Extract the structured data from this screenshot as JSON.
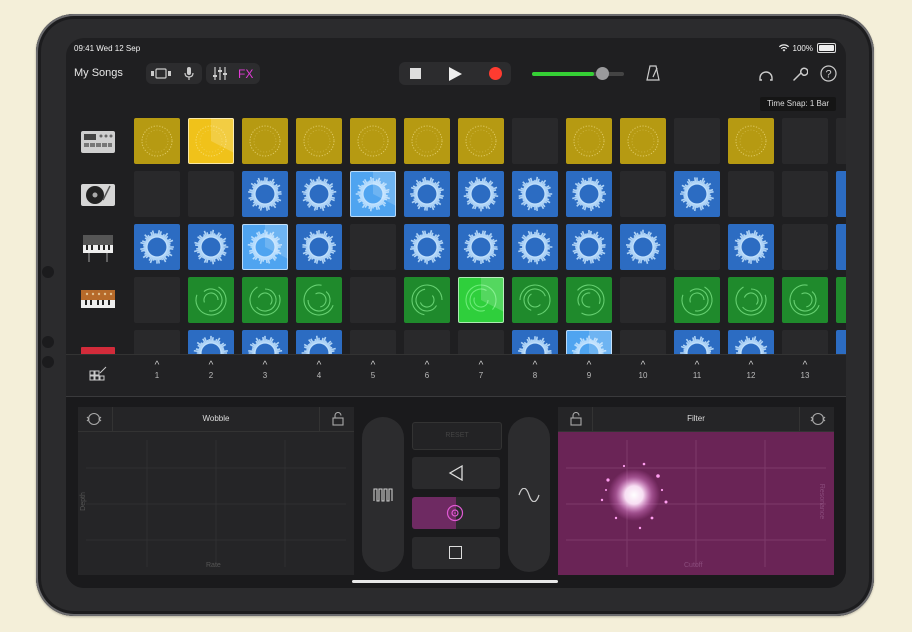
{
  "status_bar": {
    "time": "09:41",
    "date": "Wed 12 Sep",
    "battery": "100%"
  },
  "toolbar": {
    "my_songs": "My Songs",
    "fx_label": "FX",
    "time_snap": "Time Snap: 1 Bar"
  },
  "colors": {
    "accent_fx": "#e23bd6",
    "record": "#ff3b30",
    "volume": "#35d035"
  },
  "tracks": [
    {
      "icon": "drum-machine-icon",
      "color": "yellow",
      "cells": [
        "full",
        "playing",
        "full",
        "full",
        "full",
        "full",
        "full",
        "empty",
        "full",
        "full",
        "empty",
        "full",
        "empty"
      ]
    },
    {
      "icon": "turntable-icon",
      "color": "blue",
      "cells": [
        "empty",
        "empty",
        "full",
        "full",
        "playing",
        "full",
        "full",
        "full",
        "full",
        "empty",
        "full",
        "empty",
        "empty"
      ]
    },
    {
      "icon": "synth-keyboard-icon",
      "color": "blue",
      "cells": [
        "full",
        "full",
        "playing",
        "full",
        "empty",
        "full",
        "full",
        "full",
        "full",
        "full",
        "empty",
        "full",
        "empty"
      ]
    },
    {
      "icon": "vintage-synth-icon",
      "color": "green",
      "cells": [
        "empty",
        "full",
        "full",
        "full",
        "empty",
        "full",
        "playing",
        "full",
        "full",
        "empty",
        "full",
        "full",
        "full"
      ]
    },
    {
      "icon": "red-keyboard-icon",
      "color": "blue",
      "cells": [
        "empty",
        "full",
        "full",
        "full",
        "empty",
        "empty",
        "empty",
        "full",
        "playing",
        "empty",
        "full",
        "full",
        "empty"
      ]
    }
  ],
  "column_triggers": [
    "1",
    "2",
    "3",
    "4",
    "5",
    "6",
    "7",
    "8",
    "9",
    "10",
    "11",
    "12",
    "13"
  ],
  "fx": {
    "left_title": "Wobble",
    "left_x_axis": "Rate",
    "left_y_axis": "Depth",
    "right_title": "Filter",
    "right_x_axis": "Cutoff",
    "right_y_axis": "Resonance",
    "reset": "RESET"
  }
}
